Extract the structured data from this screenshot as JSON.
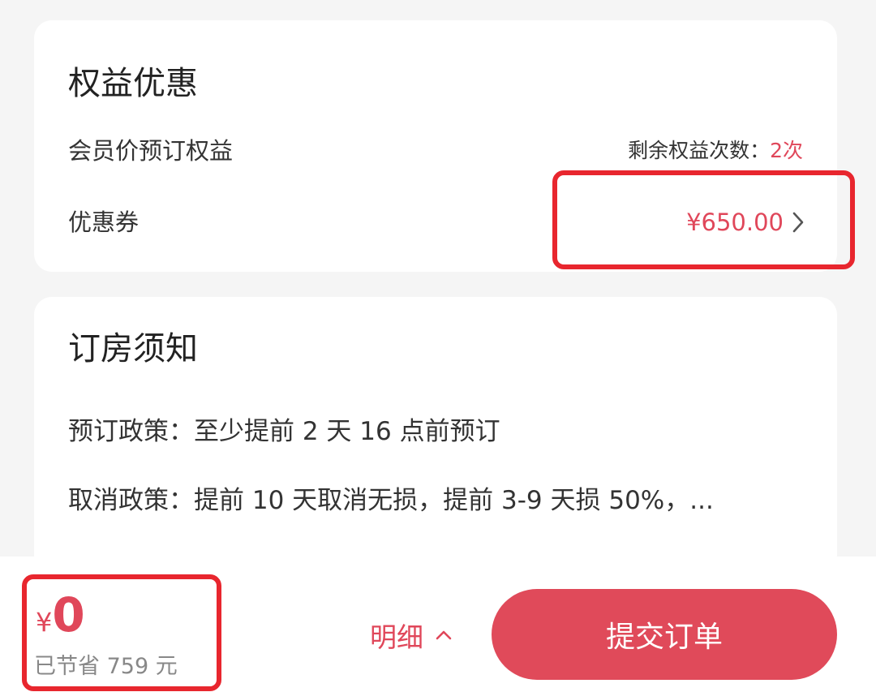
{
  "benefits": {
    "title": "权益优惠",
    "member_label": "会员价预订权益",
    "remaining_label": "剩余权益次数：",
    "remaining_value": "2次",
    "coupon_label": "优惠券",
    "coupon_value": "¥650.00"
  },
  "notice": {
    "title": "订房须知",
    "booking_policy": "预订政策：至少提前 2 天 16 点前预订",
    "cancel_policy": "取消政策：提前 10 天取消无损，提前 3-9 天损 50%，..."
  },
  "footer": {
    "currency": "¥",
    "price": "0",
    "saved_text": "已节省 759 元",
    "detail_label": "明细",
    "submit_label": "提交订单"
  },
  "colors": {
    "accent": "#e0475a",
    "button": "#e04a5a",
    "highlight_box": "#e8262e",
    "background": "#f5f5f5"
  },
  "icons": {
    "coupon_arrow": "chevron-right-icon",
    "detail_arrow": "chevron-up-icon"
  }
}
